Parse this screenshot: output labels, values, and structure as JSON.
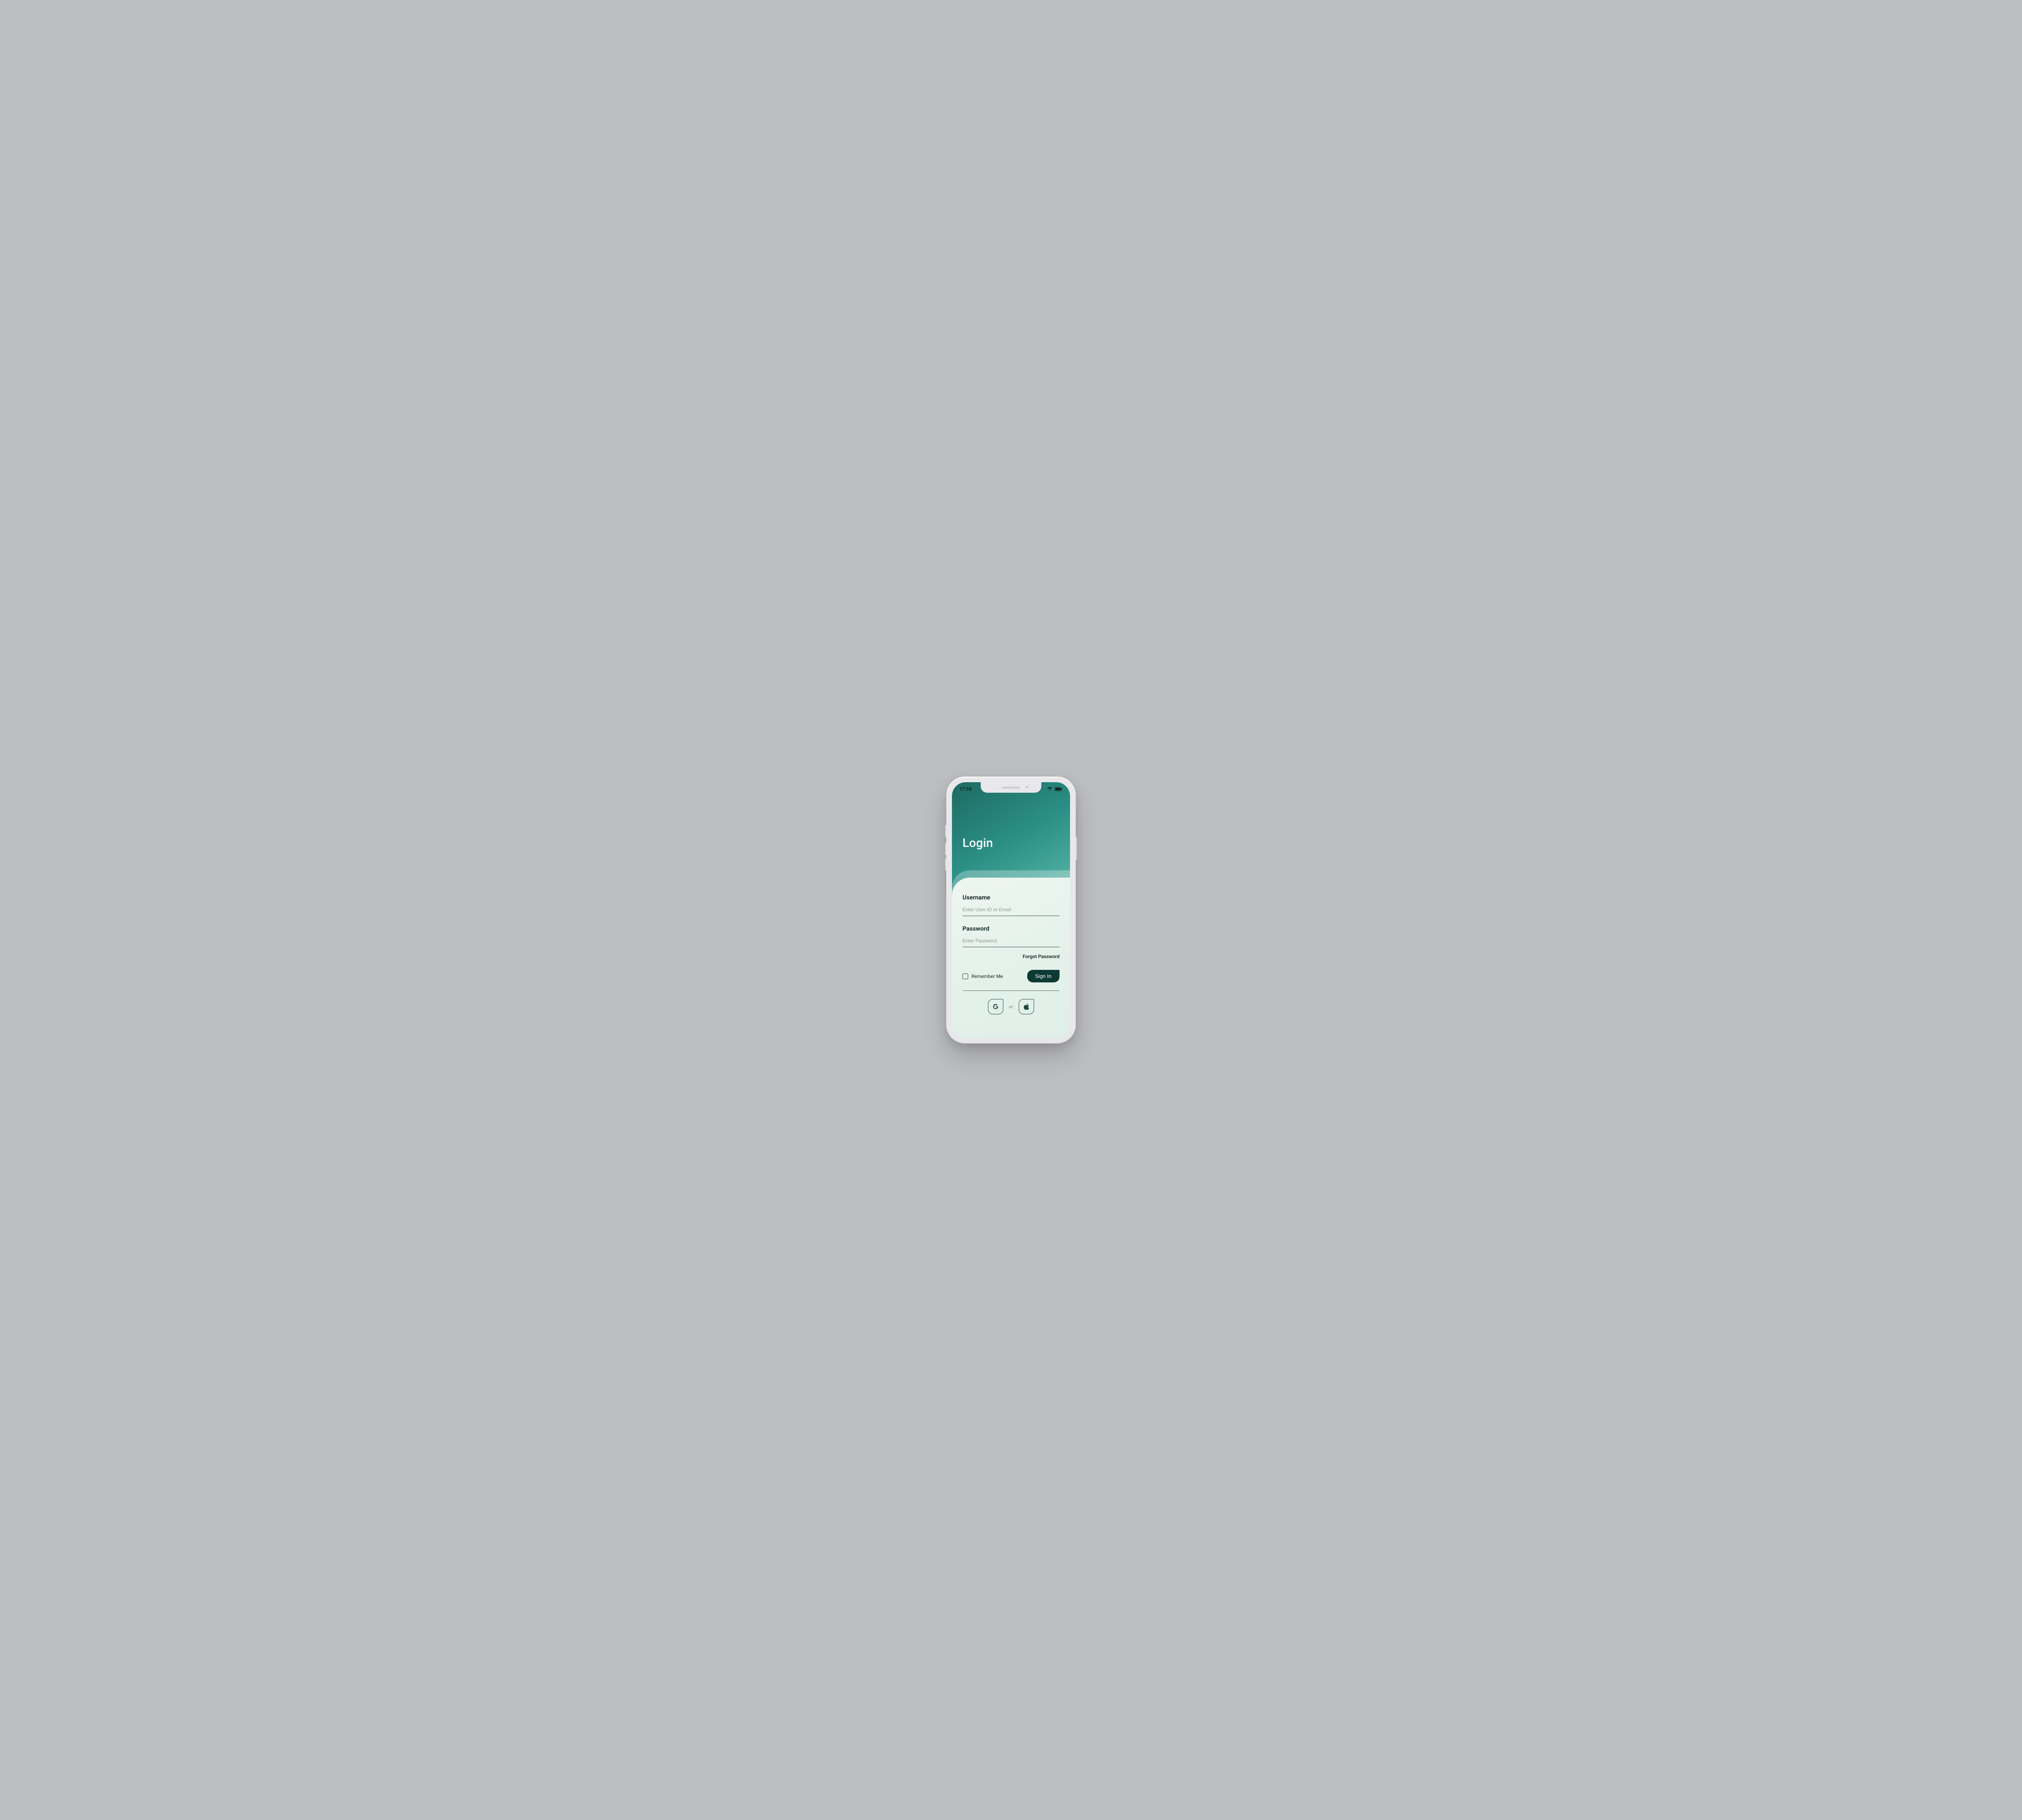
{
  "statusbar": {
    "time": "17:58"
  },
  "header": {
    "title": "Login"
  },
  "form": {
    "username_label": "Username",
    "username_placeholder": "Enter User ID or Email",
    "username_value": "",
    "password_label": "Password",
    "password_placeholder": "Enter Password",
    "password_value": "",
    "forgot_label": "Forgot Password",
    "remember_label": "Remember Me",
    "signin_label": "Sign In",
    "social_separator": "or"
  }
}
